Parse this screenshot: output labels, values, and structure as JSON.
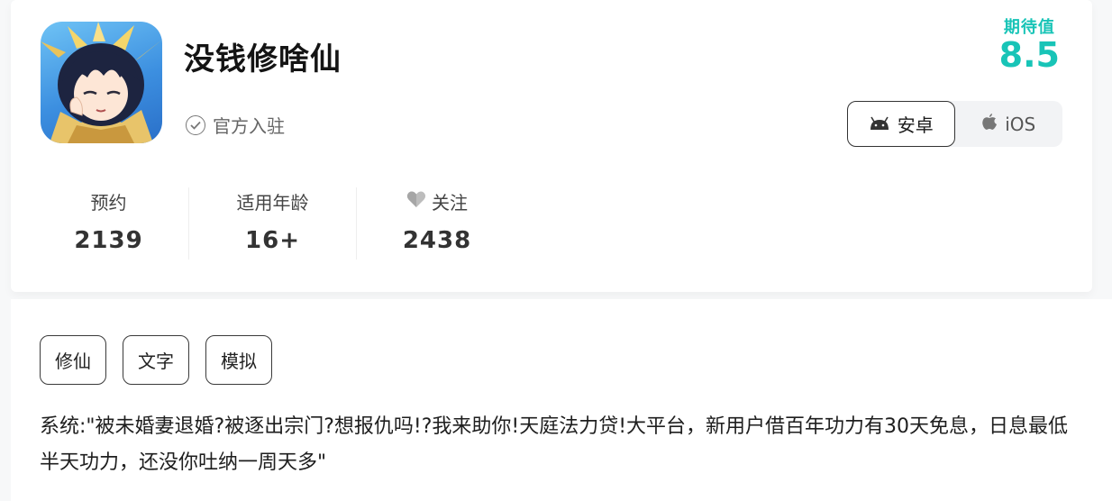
{
  "app": {
    "title": "没钱修啥仙",
    "verified_text": "官方入驻",
    "icon": "app-character-icon"
  },
  "rating": {
    "label": "期待值",
    "score": "8.5",
    "color": "#18c4b7"
  },
  "platforms": [
    {
      "label": "安卓",
      "icon": "android-icon",
      "active": true
    },
    {
      "label": "iOS",
      "icon": "apple-icon",
      "active": false
    }
  ],
  "stats": [
    {
      "label": "预约",
      "value": "2139"
    },
    {
      "label": "适用年龄",
      "value": "16+"
    },
    {
      "label": "关注",
      "value": "2438",
      "icon": "heart-icon"
    }
  ],
  "tags": [
    "修仙",
    "文字",
    "模拟"
  ],
  "description": "系统:\"被未婚妻退婚?被逐出宗门?想报仇吗!?我来助你!天庭法力贷!大平台，新用户借百年功力有30天免息，日息最低半天功力，还没你吐纳一周天多\""
}
